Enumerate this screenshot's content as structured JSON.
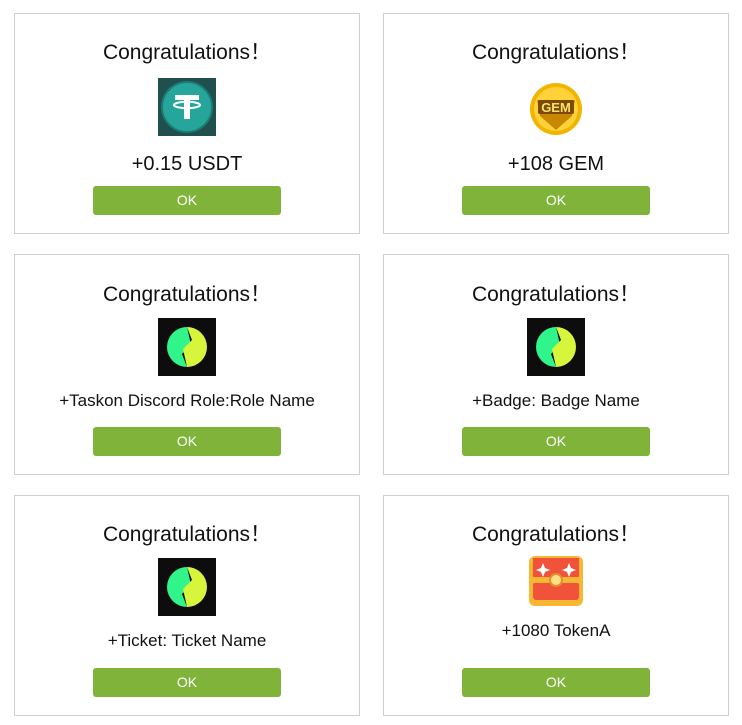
{
  "cards": [
    {
      "title": "Congratulations！",
      "icon": "tether-usdt-icon",
      "reward": "+0.15 USDT",
      "button": "OK"
    },
    {
      "title": "Congratulations！",
      "icon": "gem-coin-icon",
      "icon_text": "GEM",
      "reward": "+108 GEM",
      "button": "OK"
    },
    {
      "title": "Congratulations！",
      "icon": "taskon-logo-icon",
      "reward": "+Taskon Discord Role:Role Name",
      "button": "OK"
    },
    {
      "title": "Congratulations！",
      "icon": "taskon-logo-icon",
      "reward": "+Badge: Badge Name",
      "button": "OK"
    },
    {
      "title": "Congratulations！",
      "icon": "taskon-logo-icon",
      "reward": "+Ticket: Ticket Name",
      "button": "OK"
    },
    {
      "title": "Congratulations！",
      "icon": "treasure-chest-icon",
      "reward": "+1080 TokenA",
      "button": "OK"
    }
  ],
  "colors": {
    "button_green": "#80b33a",
    "card_border": "#cfcfcf",
    "tether_teal": "#26a69a",
    "gem_gold": "#f3b400",
    "taskon_green": "#2ff58a",
    "taskon_yellow": "#d7f53a",
    "chest_red": "#f0533a"
  }
}
